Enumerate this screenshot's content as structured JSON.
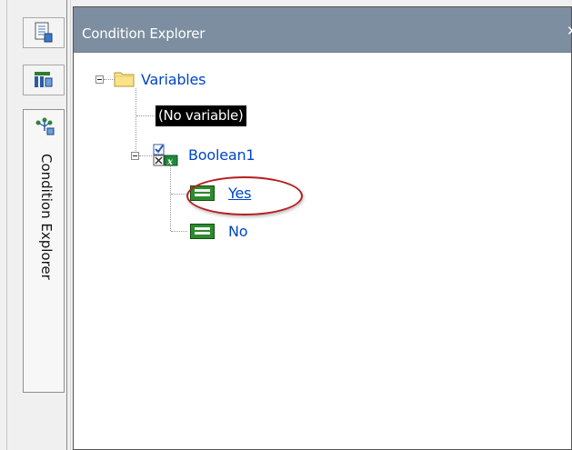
{
  "panel": {
    "title": "Condition Explorer"
  },
  "dock": {
    "tab_label": "Condition Explorer",
    "buttons": [
      {
        "icon": "document-list-icon"
      },
      {
        "icon": "grid-view-icon"
      }
    ]
  },
  "tree": {
    "root": {
      "label": "Variables",
      "icon": "folder-icon",
      "expanded": true
    },
    "no_variable": {
      "label": "(No variable)",
      "selected": true
    },
    "boolean": {
      "label": "Boolean1",
      "icon": "boolean-variable-icon",
      "expanded": true
    },
    "values": [
      {
        "label": "Yes",
        "icon": "equals-value-icon",
        "highlighted": true
      },
      {
        "label": "No",
        "icon": "equals-value-icon",
        "highlighted": false
      }
    ]
  },
  "colors": {
    "header": "#7d8ea0",
    "link": "#0045c8",
    "highlight_circle": "#b51f1f",
    "value_icon": "#2d8a2d"
  }
}
